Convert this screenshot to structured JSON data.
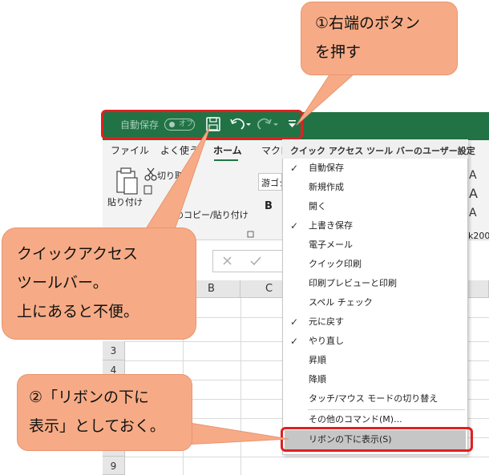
{
  "qat": {
    "autosave_label": "自動保存",
    "toggle_label": "オフ"
  },
  "tabs": [
    {
      "label": "ファイル"
    },
    {
      "label": "よく使う"
    },
    {
      "label": "ホーム"
    },
    {
      "label": "マクロ"
    }
  ],
  "ribbon": {
    "paste_label": "貼り付け",
    "cut_label": "切り取り",
    "format_painter_label": "書式のコピー/貼り付け",
    "font_name": "游ゴシック",
    "bold_label": "B",
    "fragment_right": "k200"
  },
  "grid": {
    "columns": [
      "B",
      "C"
    ],
    "rows": [
      "3",
      "4",
      "9"
    ]
  },
  "menu": {
    "title": "クイック アクセス ツール バーのユーザー設定",
    "items": [
      {
        "label": "自動保存",
        "checked": true
      },
      {
        "label": "新規作成",
        "checked": false
      },
      {
        "label": "開く",
        "checked": false
      },
      {
        "label": "上書き保存",
        "checked": true
      },
      {
        "label": "電子メール",
        "checked": false
      },
      {
        "label": "クイック印刷",
        "checked": false
      },
      {
        "label": "印刷プレビューと印刷",
        "checked": false
      },
      {
        "label": "スペル チェック",
        "checked": false
      },
      {
        "label": "元に戻す",
        "checked": true
      },
      {
        "label": "やり直し",
        "checked": true
      },
      {
        "label": "昇順",
        "checked": false
      },
      {
        "label": "降順",
        "checked": false
      },
      {
        "label": "タッチ/マウス モードの切り替え",
        "checked": false
      },
      {
        "label": "その他のコマンド(M)...",
        "checked": false
      },
      {
        "label": "リボンの下に表示(S)",
        "checked": false
      }
    ]
  },
  "callouts": {
    "step1_line1": "①右端のボタン",
    "step1_line2": "を押す",
    "qat_line1": "クイックアクセス",
    "qat_line2": "ツールバー。",
    "qat_line3": "上にあると不便。",
    "step2_line1": "②「リボンの下に",
    "step2_line2": "表示」としておく。"
  },
  "colors": {
    "excel_green": "#217346",
    "callout_fill": "#f6ab86",
    "highlight_red": "#e02020"
  }
}
